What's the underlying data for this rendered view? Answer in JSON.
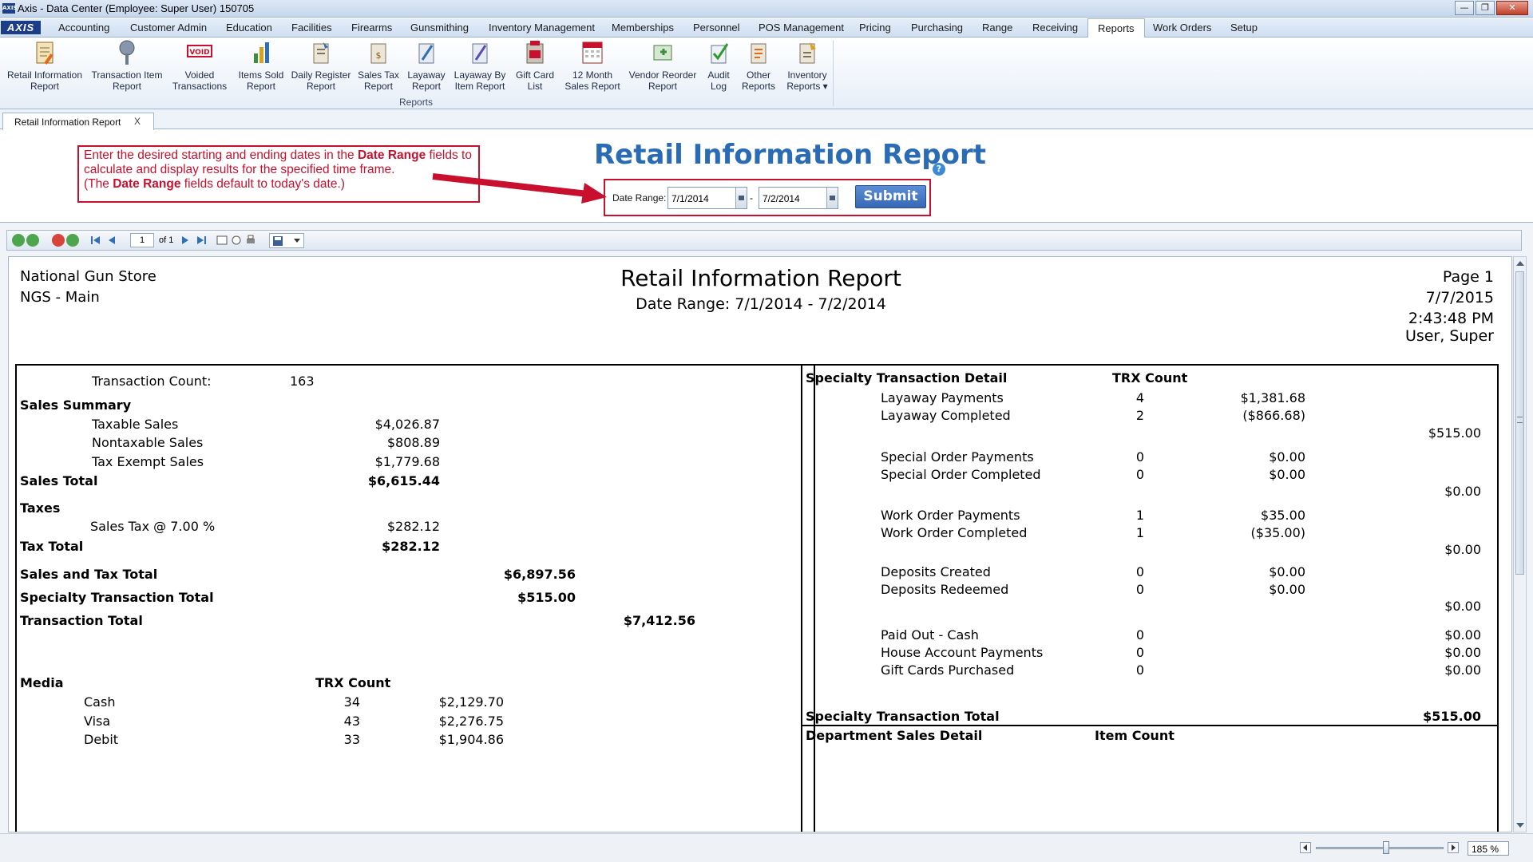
{
  "window": {
    "title": "Axis - Data Center  (Employee: Super User) 150705",
    "logo_text": "AXIS"
  },
  "menu": {
    "logo": "AXIS",
    "tabs": [
      "Accounting",
      "Customer Admin",
      "Education",
      "Facilities",
      "Firearms",
      "Gunsmithing",
      "Inventory Management",
      "Memberships",
      "Personnel",
      "POS Management",
      "Pricing",
      "Purchasing",
      "Range",
      "Receiving",
      "Reports",
      "Work Orders",
      "Setup"
    ],
    "active_tab": "Reports"
  },
  "ribbon": {
    "group_label": "Reports",
    "buttons": [
      {
        "line1": "Retail Information",
        "line2": "Report",
        "icon": "report-pencil-icon"
      },
      {
        "line1": "Transaction Item",
        "line2": "Report",
        "icon": "pin-report-icon"
      },
      {
        "line1": "Voided",
        "line2": "Transactions",
        "icon": "void-stamp-icon",
        "badge": "VOID"
      },
      {
        "line1": "Items Sold",
        "line2": "Report",
        "icon": "bar-chart-icon"
      },
      {
        "line1": "Daily Register",
        "line2": "Report",
        "icon": "register-report-icon"
      },
      {
        "line1": "Sales Tax",
        "line2": "Report",
        "icon": "tax-report-icon"
      },
      {
        "line1": "Layaway",
        "line2": "Report",
        "icon": "layaway-report-icon"
      },
      {
        "line1": "Layaway By",
        "line2": "Item Report",
        "icon": "layaway-item-icon"
      },
      {
        "line1": "Gift Card",
        "line2": "List",
        "icon": "gift-card-icon"
      },
      {
        "line1": "12 Month",
        "line2": "Sales Report",
        "icon": "calendar-icon"
      },
      {
        "line1": "Vendor Reorder",
        "line2": "Report",
        "icon": "vendor-reorder-icon"
      },
      {
        "line1": "Audit",
        "line2": "Log",
        "icon": "audit-check-icon"
      },
      {
        "line1": "Other",
        "line2": "Reports",
        "icon": "other-reports-icon"
      },
      {
        "line1": "Inventory",
        "line2": "Reports ▾",
        "icon": "inventory-reports-icon"
      }
    ]
  },
  "doc_tab": {
    "label": "Retail Information Report",
    "close": "X"
  },
  "callout": {
    "part1": "Enter the desired starting and ending dates in the ",
    "bold1": "Date Range",
    "part2": " fields to calculate and display results for the specified time frame.",
    "part3": "(The ",
    "bold2": "Date Range",
    "part4": " fields default to today's date.)"
  },
  "page_title": "Retail Information Report",
  "help_icon": "?",
  "date_range": {
    "label": "Date Range:",
    "start": "7/1/2014",
    "separator": "-",
    "end": "7/2/2014",
    "submit": "Submit"
  },
  "viewer_toolbar": {
    "page": "1",
    "of": "of 1"
  },
  "report": {
    "store_name": "National Gun Store",
    "store_location": "NGS - Main",
    "title": "Retail Information Report",
    "date_range": "Date Range: 7/1/2014 - 7/2/2014",
    "page": "Page 1",
    "date": "7/7/2015",
    "time": "2:43:48 PM",
    "user": "User, Super",
    "left": {
      "transaction_count_label": "Transaction Count:",
      "transaction_count": "163",
      "sales_summary": "Sales Summary",
      "taxable_label": "Taxable Sales",
      "taxable": "$4,026.87",
      "nontaxable_label": "Nontaxable Sales",
      "nontaxable": "$808.89",
      "exempt_label": "Tax Exempt Sales",
      "exempt": "$1,779.68",
      "sales_total_label": "Sales Total",
      "sales_total": "$6,615.44",
      "taxes": "Taxes",
      "sales_tax_label": "Sales Tax @ 7.00 %",
      "sales_tax": "$282.12",
      "tax_total_label": "Tax Total",
      "tax_total": "$282.12",
      "sales_and_tax_label": "Sales and Tax Total",
      "sales_and_tax": "$6,897.56",
      "specialty_total_label": "Specialty Transaction Total",
      "specialty_total": "$515.00",
      "transaction_total_label": "Transaction Total",
      "transaction_total": "$7,412.56",
      "media_label": "Media",
      "trx_count_label": "TRX Count",
      "media": [
        {
          "name": "Cash",
          "count": "34",
          "amount": "$2,129.70"
        },
        {
          "name": "Visa",
          "count": "43",
          "amount": "$2,276.75"
        },
        {
          "name": "Debit",
          "count": "33",
          "amount": "$1,904.86"
        }
      ]
    },
    "right": {
      "header": "Specialty Transaction Detail",
      "trx_count_label": "TRX Count",
      "groups": [
        {
          "rows": [
            {
              "name": "Layaway Payments",
              "count": "4",
              "amount": "$1,381.68"
            },
            {
              "name": "Layaway Completed",
              "count": "2",
              "amount": "($866.68)"
            }
          ],
          "subtotal": "$515.00"
        },
        {
          "rows": [
            {
              "name": "Special Order Payments",
              "count": "0",
              "amount": "$0.00"
            },
            {
              "name": "Special Order Completed",
              "count": "0",
              "amount": "$0.00"
            }
          ],
          "subtotal": "$0.00"
        },
        {
          "rows": [
            {
              "name": "Work Order Payments",
              "count": "1",
              "amount": "$35.00"
            },
            {
              "name": "Work Order Completed",
              "count": "1",
              "amount": "($35.00)"
            }
          ],
          "subtotal": "$0.00"
        },
        {
          "rows": [
            {
              "name": "Deposits Created",
              "count": "0",
              "amount": "$0.00"
            },
            {
              "name": "Deposits Redeemed",
              "count": "0",
              "amount": "$0.00"
            }
          ],
          "subtotal": "$0.00"
        }
      ],
      "misc": [
        {
          "name": "Paid Out - Cash",
          "count": "0",
          "amount": "$0.00"
        },
        {
          "name": "House Account Payments",
          "count": "0",
          "amount": "$0.00"
        },
        {
          "name": "Gift Cards Purchased",
          "count": "0",
          "amount": "$0.00"
        }
      ],
      "specialty_total_label": "Specialty Transaction Total",
      "specialty_total": "$515.00",
      "dept_header": "Department Sales Detail",
      "item_count_label": "Item Count"
    }
  },
  "zoom": {
    "value": "185 %",
    "level_percent": 55
  }
}
